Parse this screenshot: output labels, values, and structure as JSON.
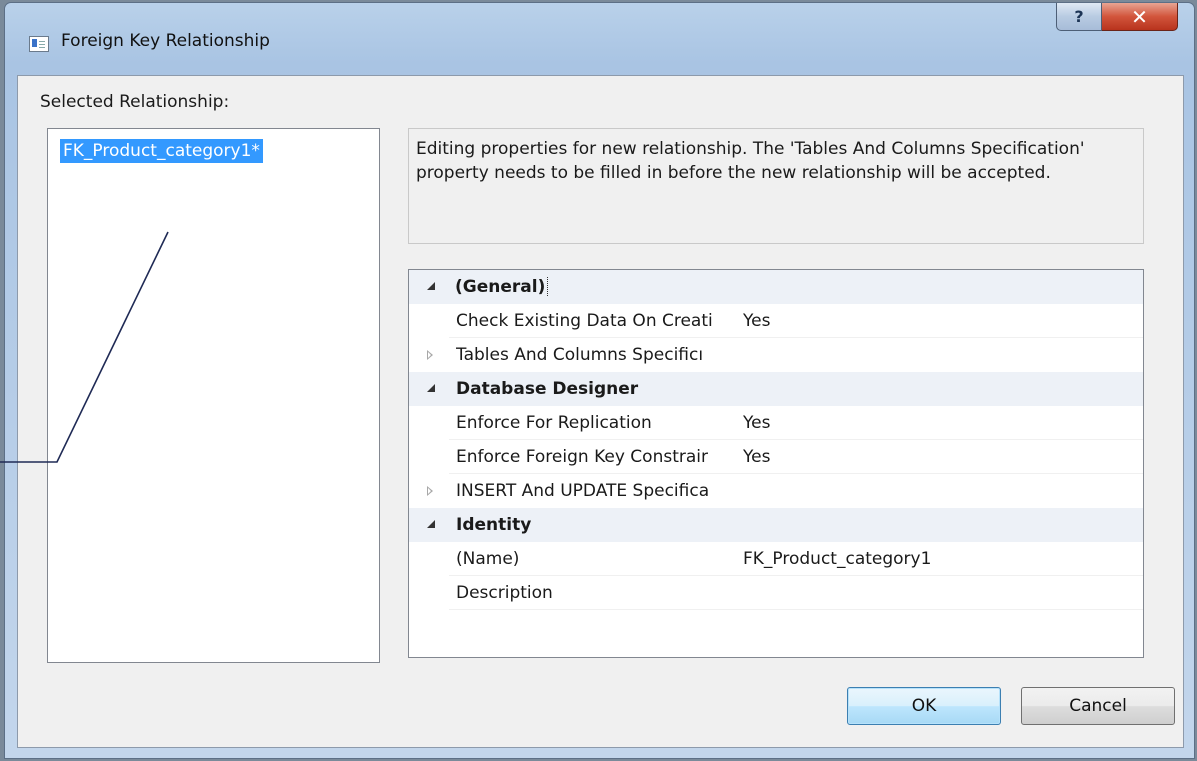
{
  "window": {
    "title": "Foreign Key Relationship",
    "help_label": "?",
    "close_label": "✕"
  },
  "selected_relationship": {
    "label": "Selected Relationship:",
    "items": [
      "FK_Product_category1*"
    ]
  },
  "description": "Editing properties for new relationship.  The 'Tables And Columns Specification' property needs to be filled in before the new relationship will be accepted.",
  "properties": {
    "general": {
      "category": "(General)",
      "rows": [
        {
          "name": "Check Existing Data On Creati",
          "value": "Yes"
        },
        {
          "name": "Tables And Columns Specificı",
          "value": ""
        }
      ]
    },
    "database_designer": {
      "category": "Database Designer",
      "rows": [
        {
          "name": "Enforce For Replication",
          "value": "Yes"
        },
        {
          "name": "Enforce Foreign Key Constrair",
          "value": "Yes"
        },
        {
          "name": "INSERT And UPDATE Specifica",
          "value": ""
        }
      ]
    },
    "identity": {
      "category": "Identity",
      "rows": [
        {
          "name": "(Name)",
          "value": "FK_Product_category1"
        },
        {
          "name": "Description",
          "value": ""
        }
      ]
    }
  },
  "buttons": {
    "ok": "OK",
    "cancel": "Cancel"
  },
  "colors": {
    "selection": "#3399ff",
    "title_bar": "#b9d1ea",
    "close_button": "#c7432b"
  },
  "icons": {
    "window_icon": "relationship-icon",
    "expand_glyph": "expanded-triangle-icon",
    "collapse_glyph": "collapsed-triangle-icon"
  }
}
